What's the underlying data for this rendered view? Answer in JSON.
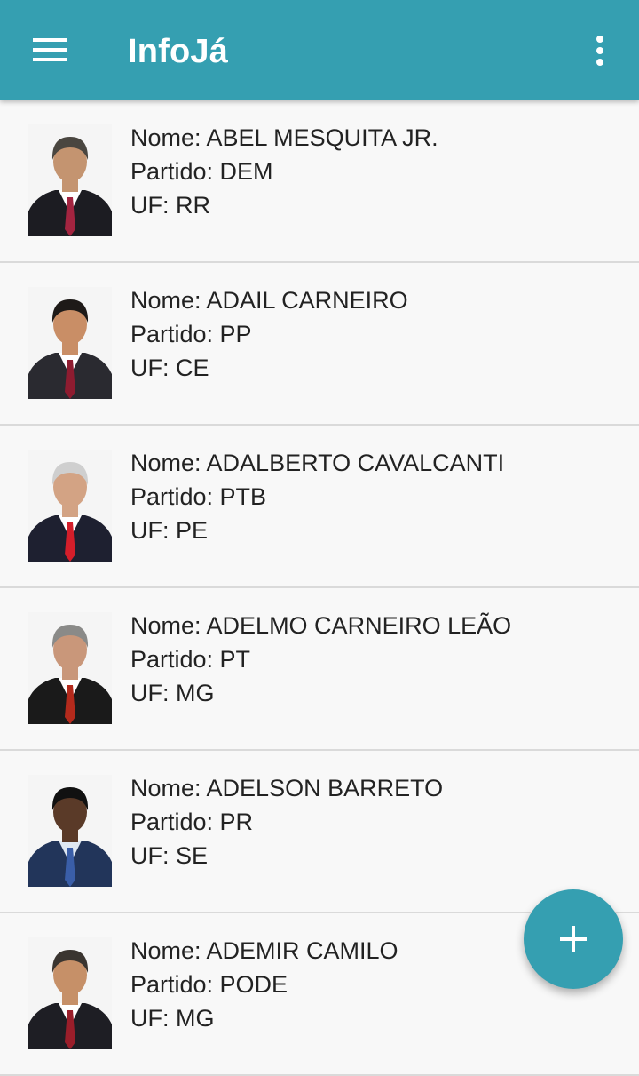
{
  "app": {
    "title": "InfoJá",
    "menu_icon": "menu-icon",
    "overflow_icon": "more-vert-icon",
    "accent_color": "#359fb1"
  },
  "list": {
    "items": [
      {
        "nome": "Nome: ABEL MESQUITA JR.",
        "partido": "Partido: DEM",
        "uf": "UF: RR",
        "photo": {
          "skin": "#c49470",
          "hair": "#4a4640",
          "suit": "#1c1c22",
          "tie": "#a32440",
          "shirt": "#ffffff"
        }
      },
      {
        "nome": "Nome: ADAIL CARNEIRO",
        "partido": "Partido: PP",
        "uf": "UF: CE",
        "photo": {
          "skin": "#c98e66",
          "hair": "#1e1a18",
          "suit": "#2a2a30",
          "tie": "#8e1c30",
          "shirt": "#ffffff"
        }
      },
      {
        "nome": "Nome: ADALBERTO CAVALCANTI",
        "partido": "Partido: PTB",
        "uf": "UF: PE",
        "photo": {
          "skin": "#d3a384",
          "hair": "#cfcfcf",
          "suit": "#1e2030",
          "tie": "#d41e2a",
          "shirt": "#ffffff"
        }
      },
      {
        "nome": "Nome: ADELMO CARNEIRO LEÃO",
        "partido": "Partido: PT",
        "uf": "UF: MG",
        "photo": {
          "skin": "#c9977a",
          "hair": "#8a8a88",
          "suit": "#1a1a1a",
          "tie": "#b42a1c",
          "shirt": "#ffffff"
        }
      },
      {
        "nome": "Nome: ADELSON BARRETO",
        "partido": "Partido: PR",
        "uf": "UF: SE",
        "photo": {
          "skin": "#5a3a28",
          "hair": "#111111",
          "suit": "#22355a",
          "tie": "#3a5ea8",
          "shirt": "#dfe8f2"
        }
      },
      {
        "nome": "Nome: ADEMIR CAMILO",
        "partido": "Partido: PODE",
        "uf": "UF: MG",
        "photo": {
          "skin": "#c69068",
          "hair": "#3a3530",
          "suit": "#1e1e24",
          "tie": "#9a1e2a",
          "shirt": "#ffffff"
        }
      }
    ]
  },
  "fab": {
    "icon": "add-icon"
  }
}
